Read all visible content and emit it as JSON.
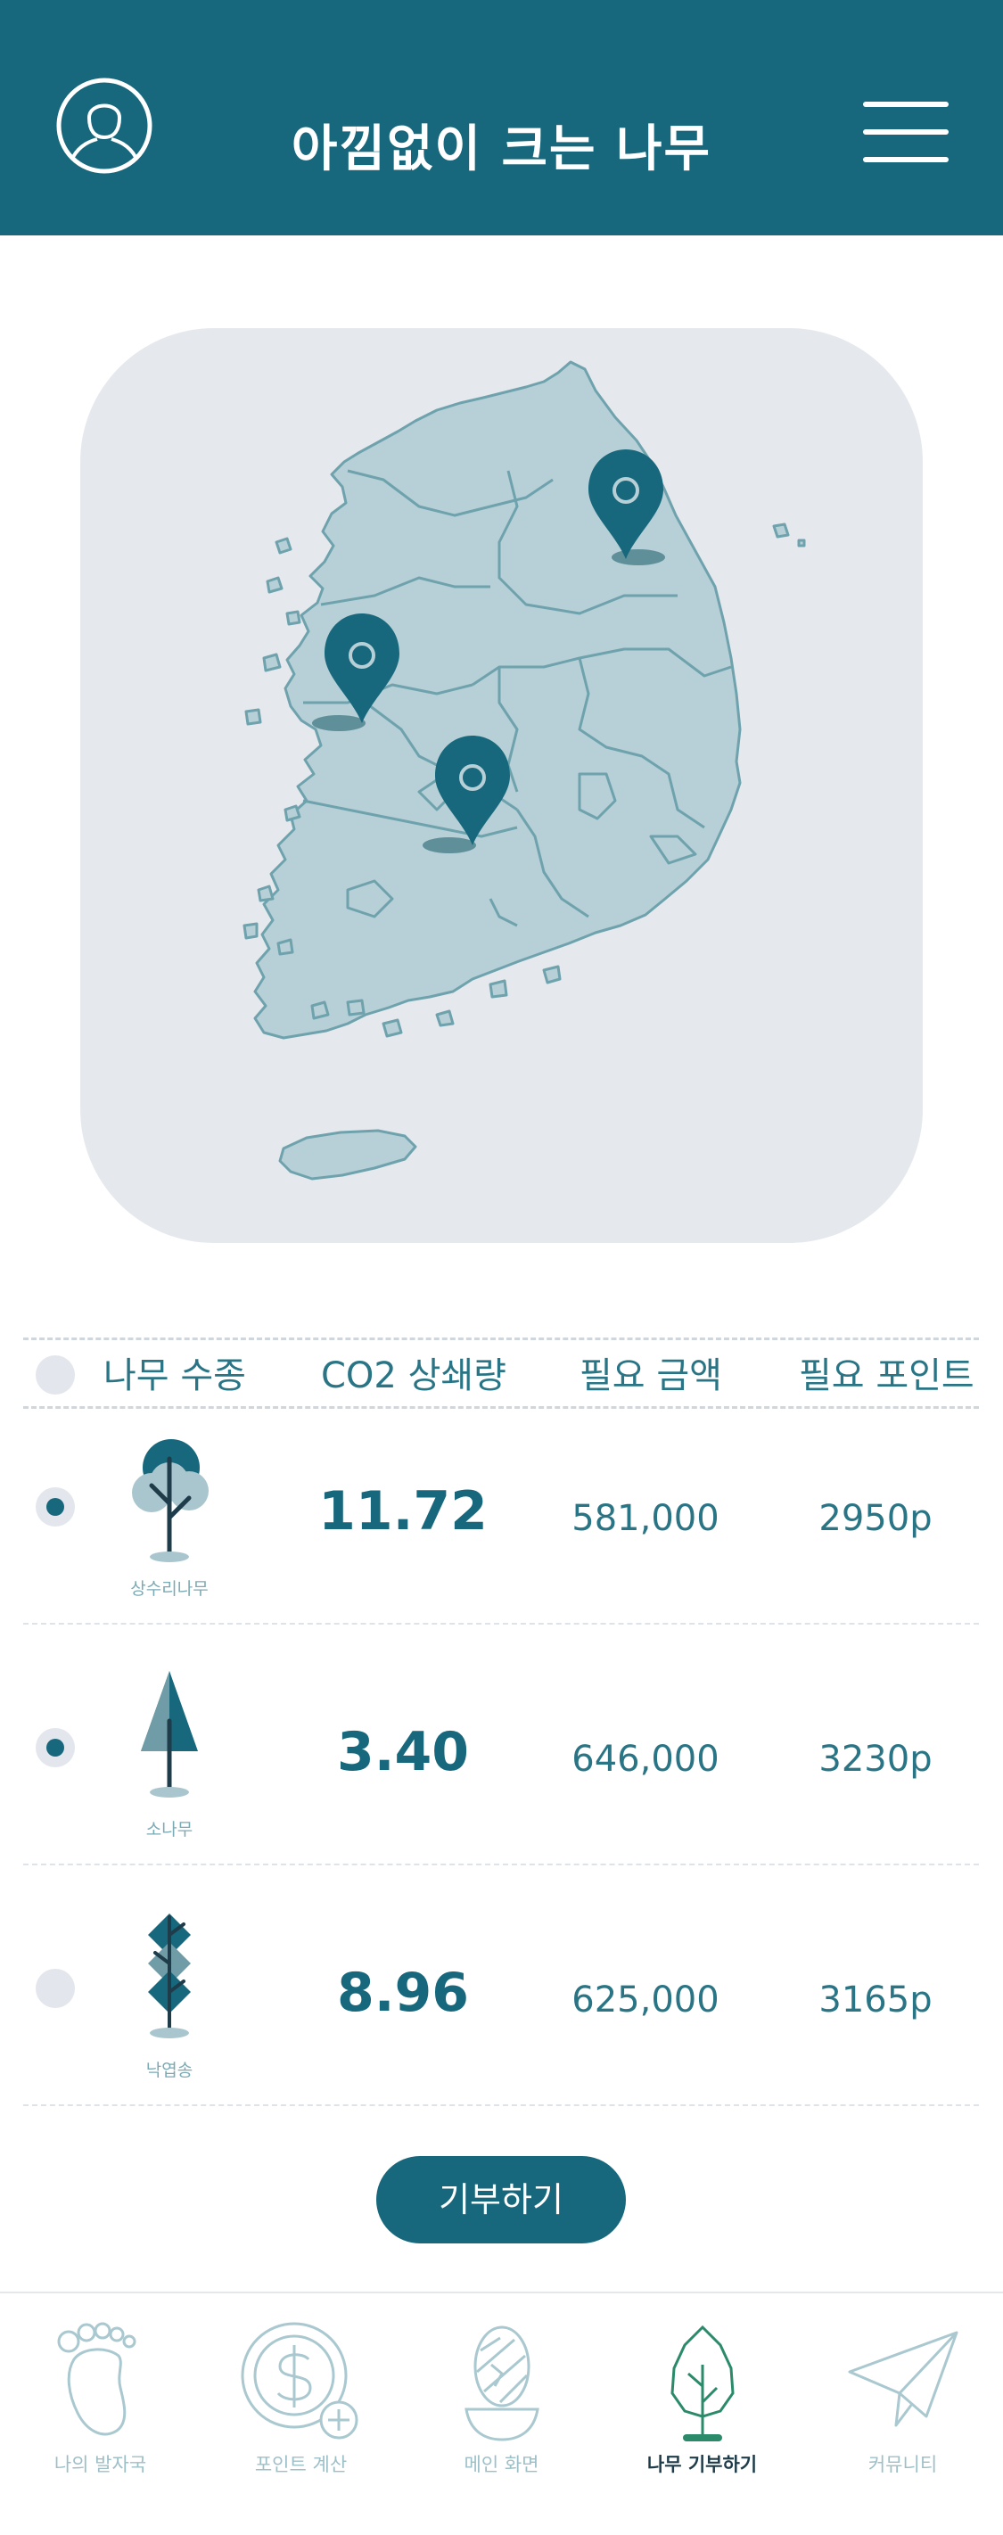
{
  "app": {
    "title": "아낌없이 크는 나무"
  },
  "table": {
    "headers": [
      "나무 수종",
      "CO2 상쇄량",
      "필요 금액",
      "필요 포인트"
    ],
    "rows": [
      {
        "name": "상수리나무",
        "co2": "11.72",
        "amount": "581,000",
        "points": "2950p",
        "selected": true
      },
      {
        "name": "소나무",
        "co2": "3.40",
        "amount": "646,000",
        "points": "3230p",
        "selected": true
      },
      {
        "name": "낙엽송",
        "co2": "8.96",
        "amount": "625,000",
        "points": "3165p",
        "selected": false
      }
    ]
  },
  "donate_button": "기부하기",
  "tabs": [
    {
      "label": "나의 발자국",
      "icon": "footprint-icon",
      "active": false
    },
    {
      "label": "포인트 계산",
      "icon": "dollar-coin-icon",
      "active": false
    },
    {
      "label": "메인 화면",
      "icon": "earth-bowl-icon",
      "active": false
    },
    {
      "label": "나무 기부하기",
      "icon": "tree-icon",
      "active": true
    },
    {
      "label": "커뮤니티",
      "icon": "paper-plane-icon",
      "active": false
    }
  ],
  "colors": {
    "primary": "#17687c",
    "map_land": "#b7cfd6",
    "card_bg": "#e5e8ed"
  }
}
